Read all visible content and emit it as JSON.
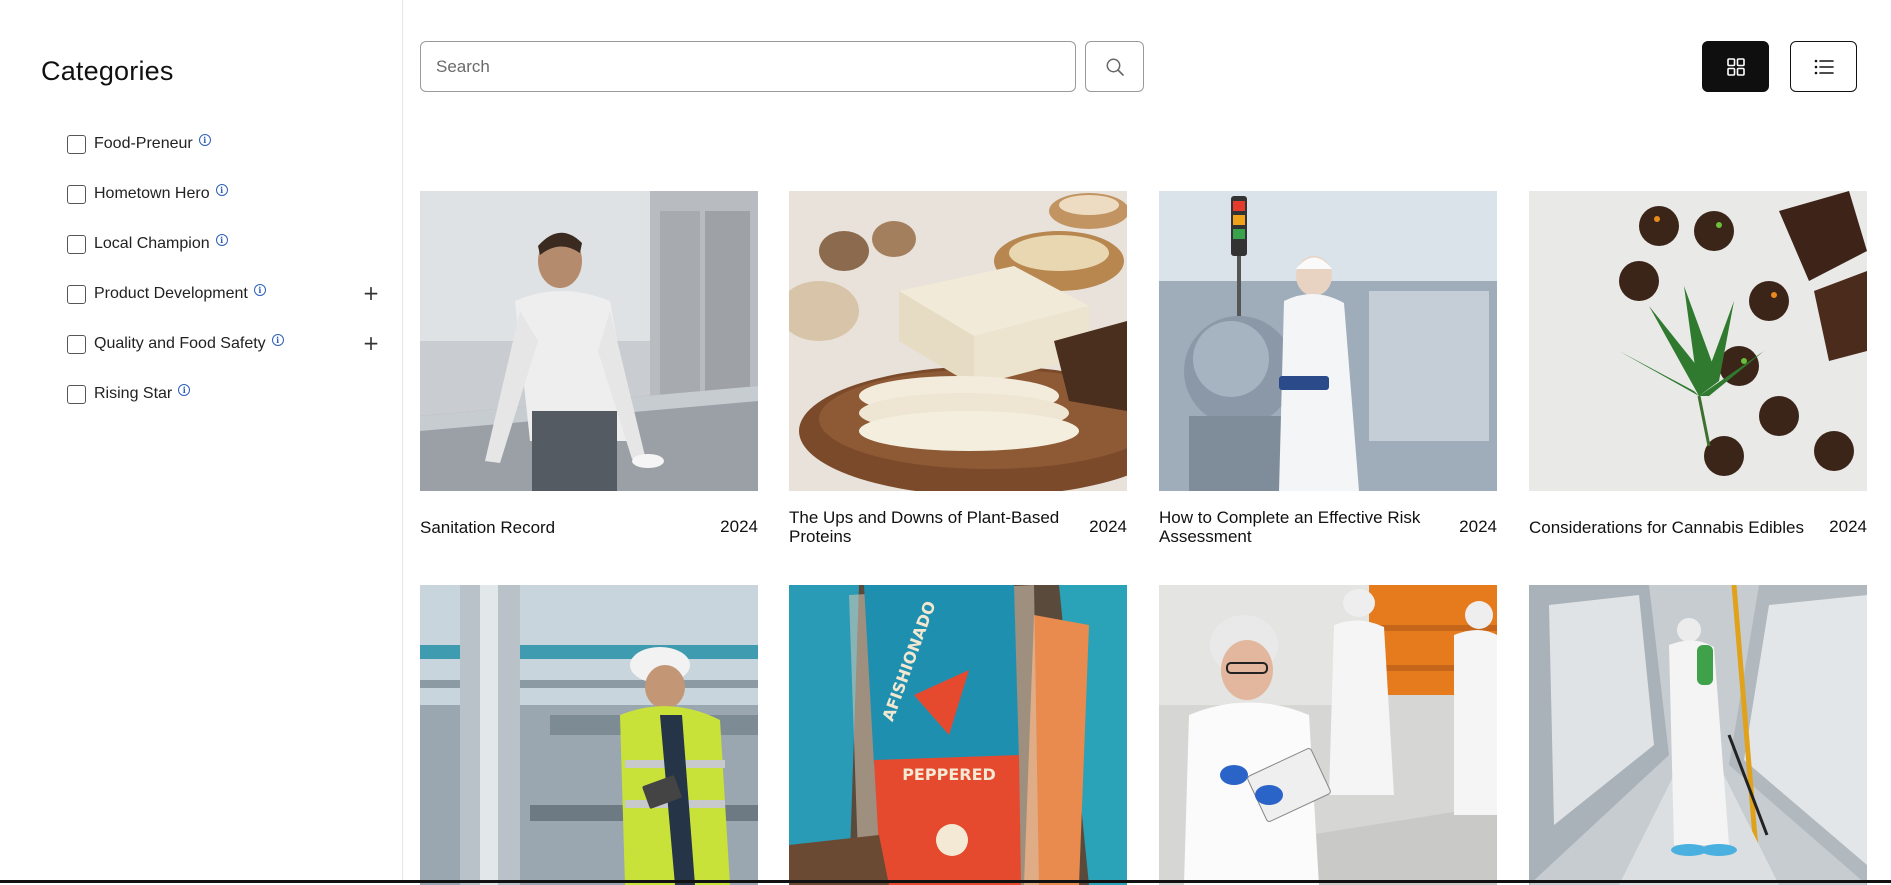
{
  "sidebar": {
    "title": "Categories",
    "categories": [
      {
        "label": "Food-Preneur",
        "checked": false,
        "expandable": false
      },
      {
        "label": "Hometown Hero",
        "checked": false,
        "expandable": false
      },
      {
        "label": "Local Champion",
        "checked": false,
        "expandable": false
      },
      {
        "label": "Product Development",
        "checked": false,
        "expandable": true
      },
      {
        "label": "Quality and Food Safety",
        "checked": false,
        "expandable": true
      },
      {
        "label": "Rising Star",
        "checked": false,
        "expandable": false
      }
    ],
    "expand_symbol": "+",
    "info_symbol": "i"
  },
  "toolbar": {
    "search_placeholder": "Search",
    "search_value": "",
    "search_icon": "search-icon",
    "view_grid_icon": "grid-view-icon",
    "view_list_icon": "list-view-icon",
    "active_view": "grid",
    "active_color": "#0f0f0f"
  },
  "cards": [
    {
      "title": "Sanitation Record",
      "year": "2024",
      "image": "chef wiping stainless steel counter"
    },
    {
      "title": "The Ups and Downs of Plant-Based Proteins",
      "year": "2024",
      "image": "tofu slices with mushrooms and chickpeas"
    },
    {
      "title": "How to Complete an Effective Risk Assessment",
      "year": "2024",
      "image": "inspector in factory with clipboard"
    },
    {
      "title": "Considerations for Cannabis Edibles",
      "year": "2024",
      "image": "chocolates with cannabis leaf"
    },
    {
      "title": "",
      "year": "",
      "image": "engineer in hard hat and hi-vis vest"
    },
    {
      "title": "",
      "year": "",
      "image": "packaged peppered smoked salmon",
      "image_text": [
        "AFISHIONADO",
        "PEPPERED"
      ]
    },
    {
      "title": "",
      "year": "",
      "image": "food safety inspectors in hairnets"
    },
    {
      "title": "",
      "year": "",
      "image": "worker spraying warehouse aisle"
    }
  ]
}
